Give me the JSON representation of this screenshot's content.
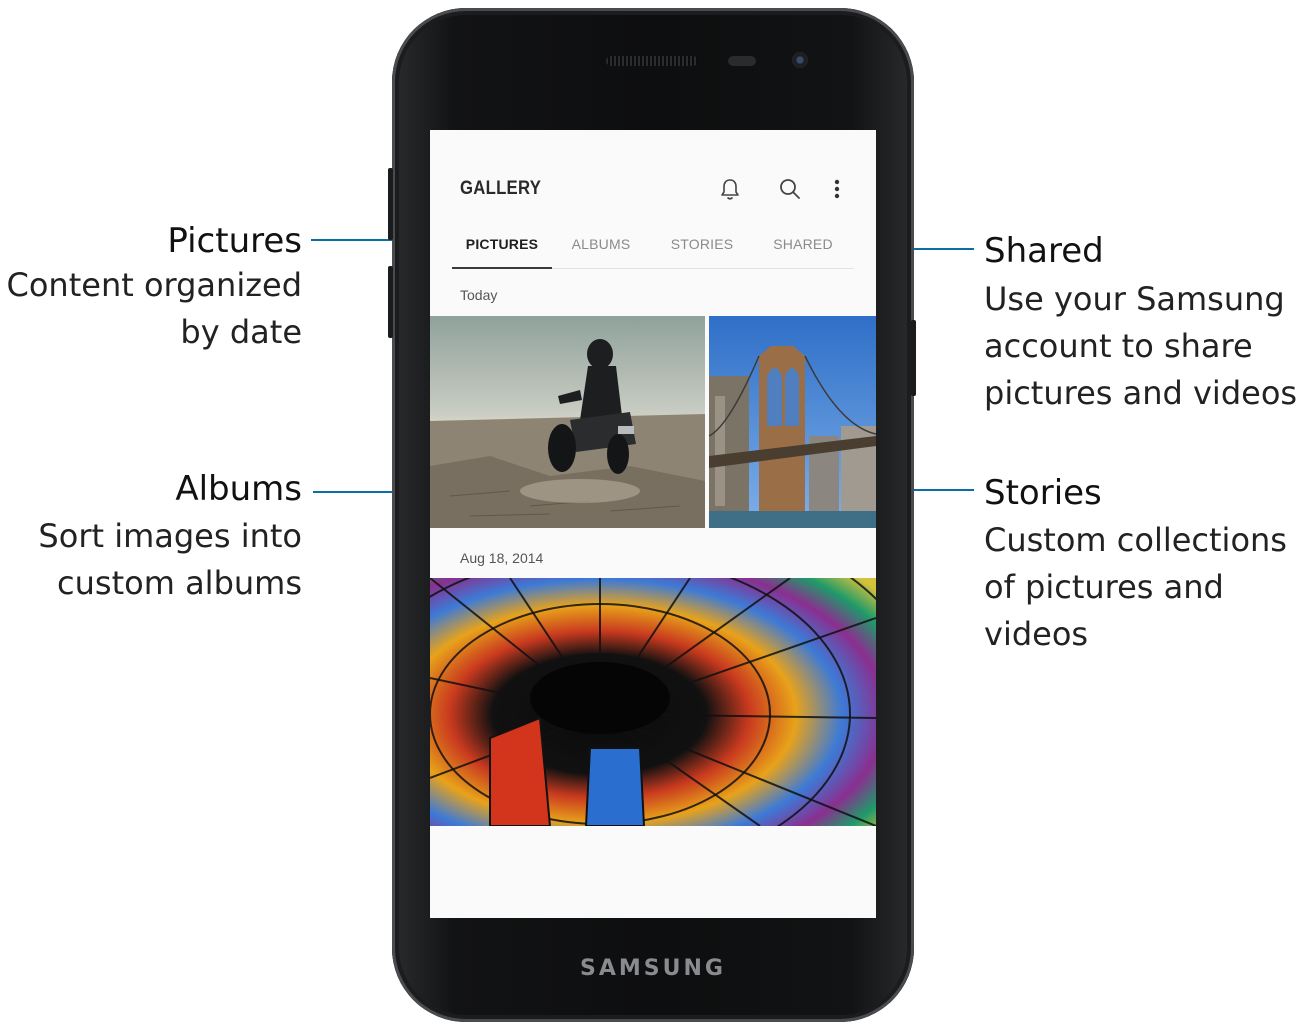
{
  "callouts": {
    "pictures": {
      "title": "Pictures",
      "description_lines": [
        "Content organized",
        "by date"
      ]
    },
    "albums": {
      "title": "Albums",
      "description_lines": [
        "Sort images into",
        "custom albums"
      ]
    },
    "shared": {
      "title": "Shared",
      "description_lines": [
        "Use your Samsung",
        "account to share",
        "pictures and videos"
      ]
    },
    "stories": {
      "title": "Stories",
      "description_lines": [
        "Custom collections",
        "of pictures and",
        "videos"
      ]
    }
  },
  "phone": {
    "brand": "SAMSUNG"
  },
  "app": {
    "title": "GALLERY",
    "icons": [
      "bell-icon",
      "search-icon",
      "more-options-icon"
    ],
    "tabs": [
      {
        "label": "PICTURES",
        "active": true
      },
      {
        "label": "ALBUMS",
        "active": false
      },
      {
        "label": "STORIES",
        "active": false
      },
      {
        "label": "SHARED",
        "active": false
      }
    ],
    "sections": [
      {
        "date": "Today",
        "items": [
          "motorcycle-desert-photo",
          "bridge-photo"
        ]
      },
      {
        "date": "Aug 18, 2014",
        "items": [
          "stained-glass-dome-photo"
        ]
      }
    ]
  },
  "colors": {
    "callout_line": "#0b6fa6",
    "phone_body": "#121314",
    "active_tab": "#1f1f1f",
    "inactive_tab": "#8a8a8a"
  }
}
